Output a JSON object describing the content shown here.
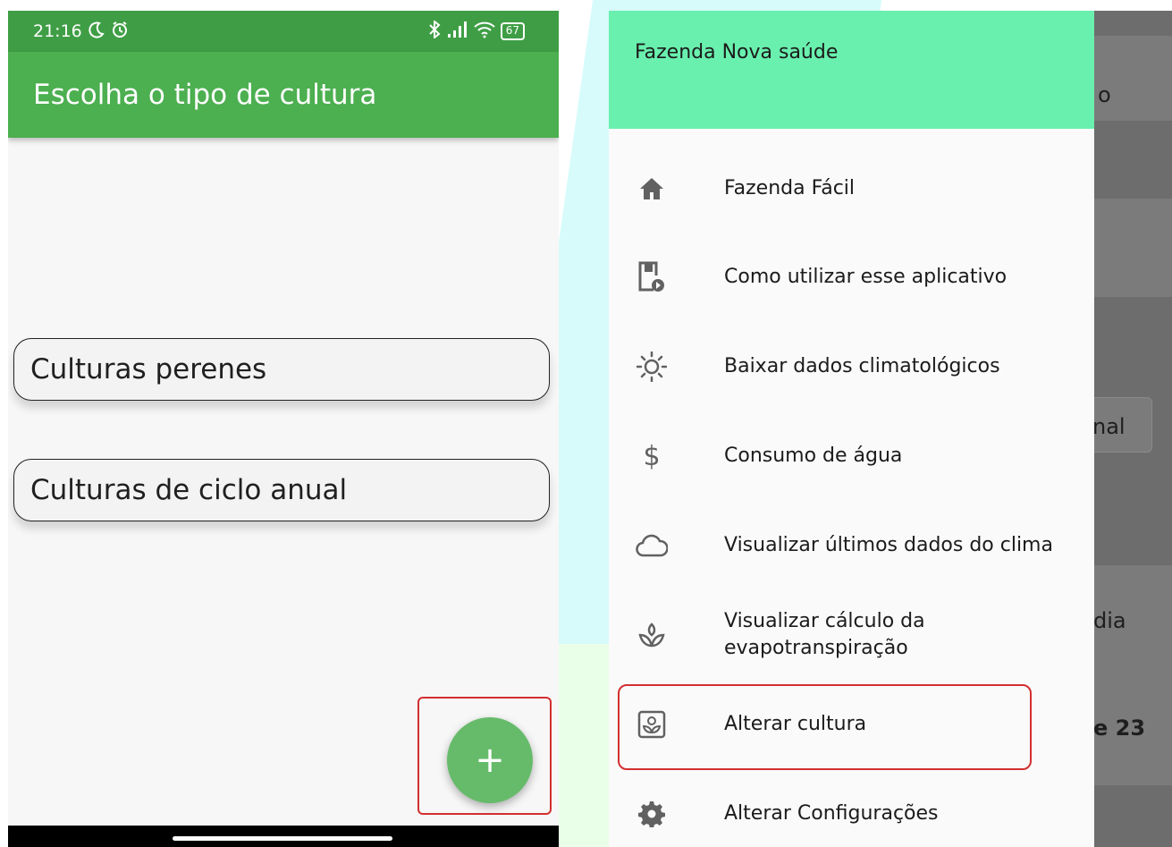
{
  "left_screen": {
    "status_bar": {
      "time": "21:16",
      "moon_icon": "moon-icon",
      "alarm_icon": "alarm-icon",
      "bluetooth_icon": "bluetooth-icon",
      "signal_icon": "signal-icon",
      "wifi_icon": "wifi-icon",
      "battery": "67"
    },
    "app_bar": {
      "title": "Escolha o tipo de cultura"
    },
    "options": [
      {
        "label": "Culturas perenes"
      },
      {
        "label": "Culturas de ciclo anual"
      }
    ],
    "fab": {
      "label": "+",
      "icon": "plus-icon"
    },
    "colors": {
      "status_bar": "#3f9e45",
      "app_bar": "#4caf50",
      "fab": "#66bb6a",
      "highlight": "#d32f2f"
    }
  },
  "right_screen": {
    "drawer": {
      "header_title": "Fazenda Nova saúde",
      "items": [
        {
          "label": "Fazenda Fácil",
          "icon": "home-icon"
        },
        {
          "label": "Como utilizar esse aplicativo",
          "icon": "video-guide-icon"
        },
        {
          "label": "Baixar dados climatológicos",
          "icon": "sun-icon"
        },
        {
          "label": "Consumo de água",
          "icon": "dollar-icon"
        },
        {
          "label": "Visualizar últimos dados do clima",
          "icon": "cloud-icon"
        },
        {
          "label_line1": "Visualizar cálculo da",
          "label_line2": "evapotranspiração",
          "icon": "sprout-icon"
        },
        {
          "label": "Alterar cultura",
          "icon": "flower-frame-icon"
        },
        {
          "label": "Alterar Configurações",
          "icon": "gear-icon"
        }
      ]
    },
    "background_fragments": {
      "frag1": "o",
      "frag2": "nal",
      "frag3": "dia",
      "frag4": "e 23"
    },
    "colors": {
      "drawer_header": "#69f0ae",
      "scrim": "#6d6d6d",
      "highlight": "#d32f2f"
    }
  }
}
